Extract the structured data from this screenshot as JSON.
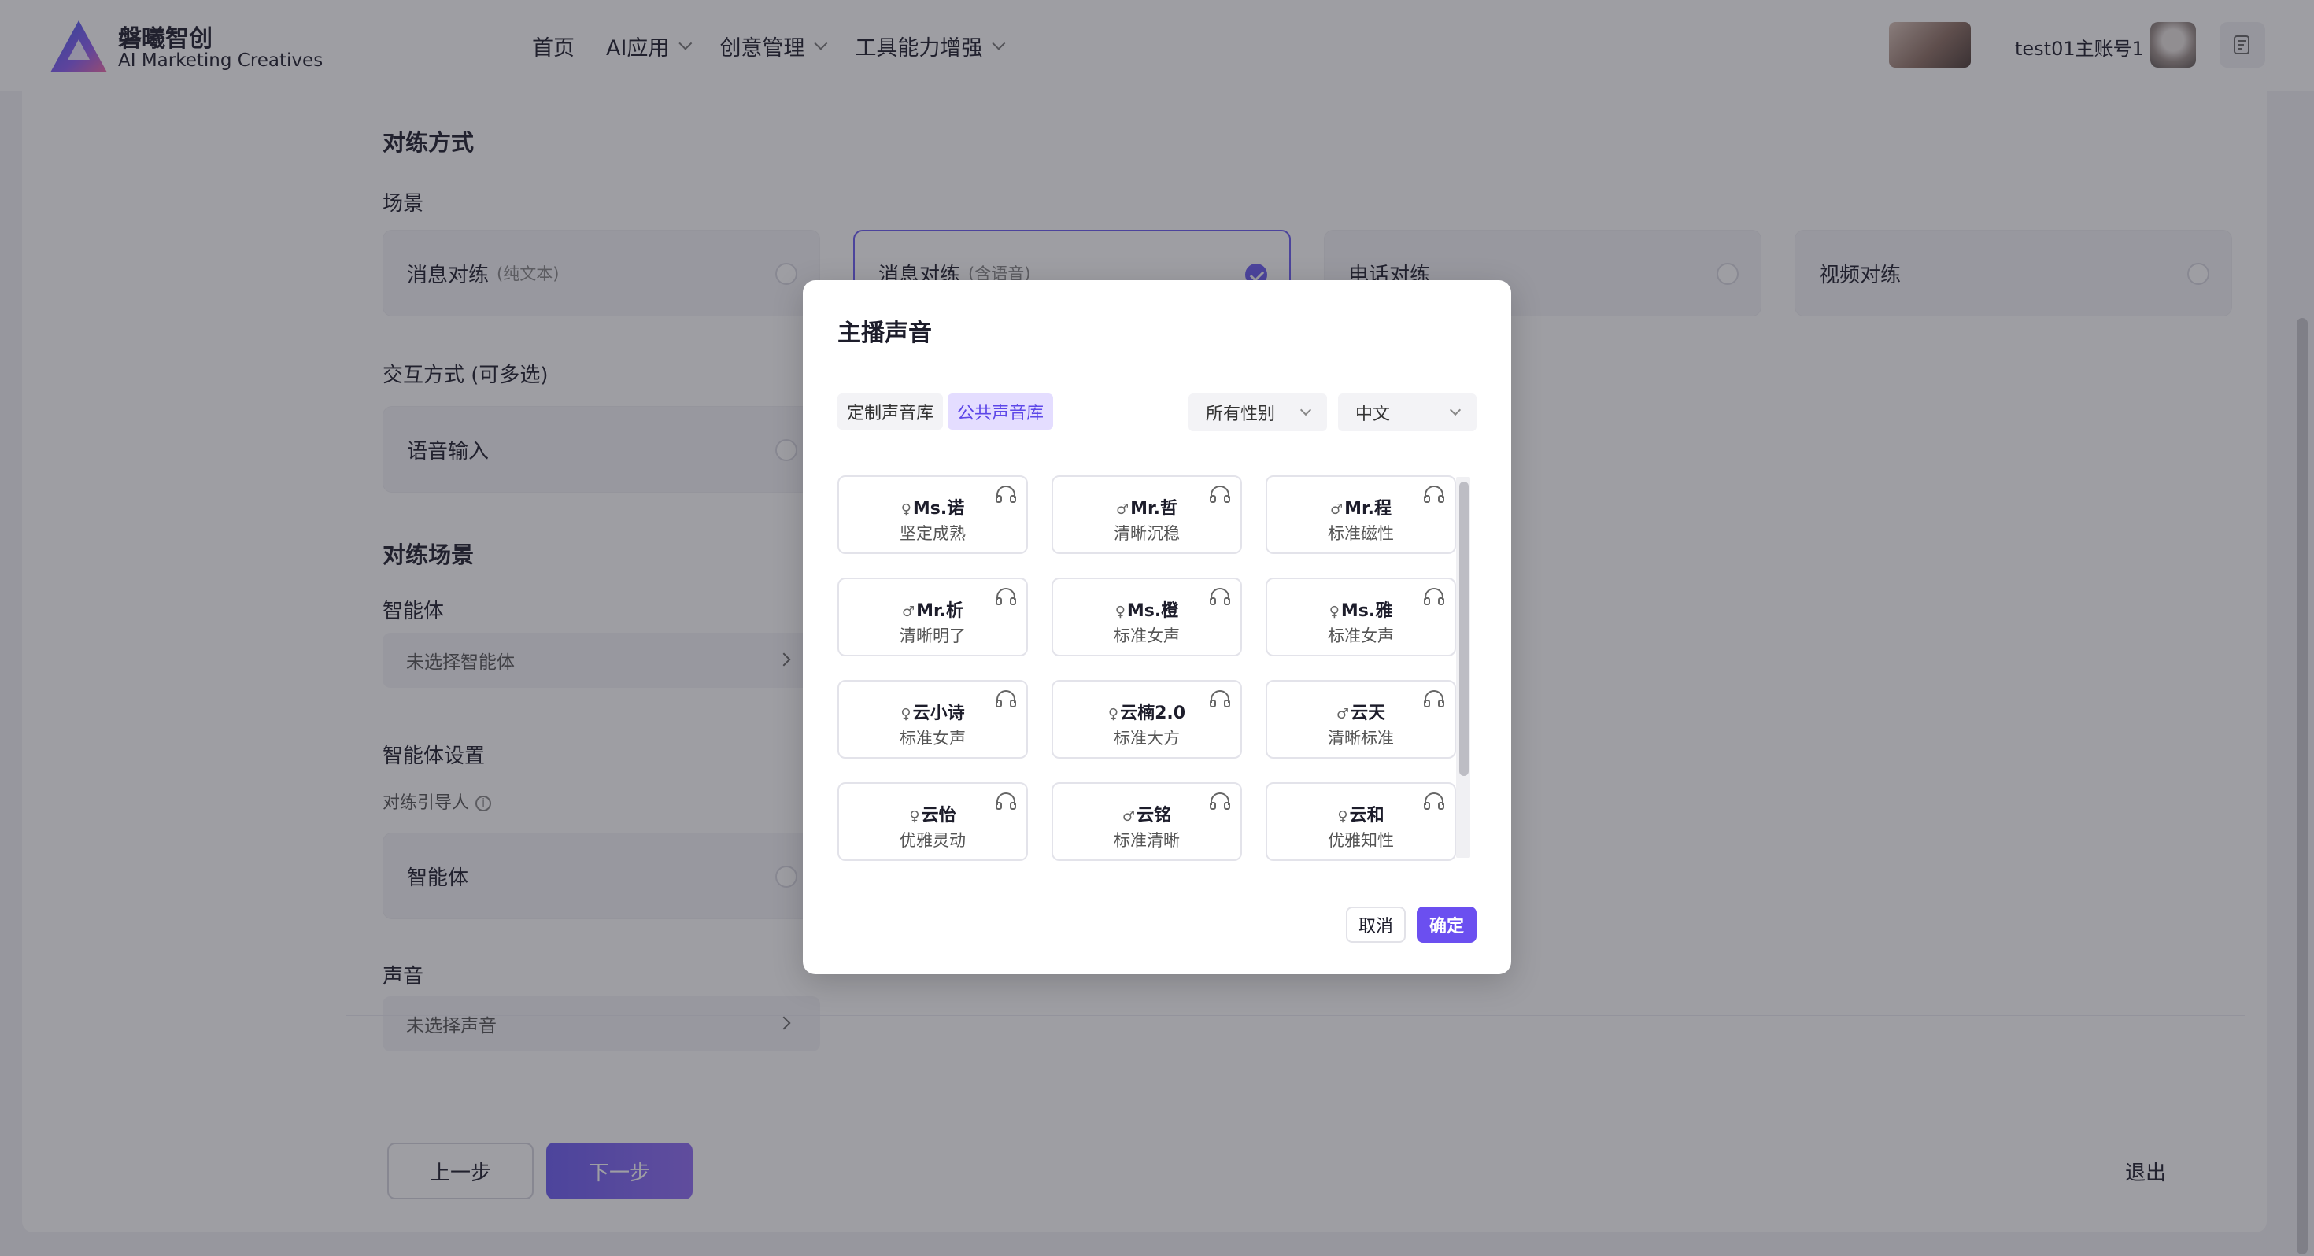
{
  "header": {
    "brand_name": "磐曦智创",
    "brand_sub": "AI Marketing Creatives",
    "nav": [
      {
        "label": "首页",
        "dropdown": false
      },
      {
        "label": "AI应用",
        "dropdown": true
      },
      {
        "label": "创意管理",
        "dropdown": true
      },
      {
        "label": "工具能力增强",
        "dropdown": true
      }
    ],
    "account_name": "test01主账号1"
  },
  "form": {
    "mode_title": "对练方式",
    "scene_label": "场景",
    "scene_options": [
      {
        "label": "消息对练",
        "hint": "(纯文本)",
        "selected": false
      },
      {
        "label": "消息对练",
        "hint": "(含语音)",
        "selected": true
      },
      {
        "label": "电话对练",
        "hint": "",
        "selected": false
      },
      {
        "label": "视频对练",
        "hint": "",
        "selected": false
      }
    ],
    "interaction_label": "交互方式 (可多选)",
    "interaction_option": "语音输入",
    "practice_scene_title": "对练场景",
    "agent_label": "智能体",
    "agent_placeholder": "未选择智能体",
    "agent_settings_title": "智能体设置",
    "guide_label": "对练引导人",
    "guide_info": "i",
    "guide_option": "智能体",
    "voice_label": "声音",
    "voice_placeholder": "未选择声音"
  },
  "footer": {
    "prev": "上一步",
    "next": "下一步",
    "exit": "退出"
  },
  "modal": {
    "title": "主播声音",
    "tabs": [
      {
        "label": "定制声音库",
        "active": false
      },
      {
        "label": "公共声音库",
        "active": true
      }
    ],
    "gender_filter": "所有性别",
    "language_filter": "中文",
    "voices": [
      {
        "gender": "♀",
        "name": "Ms.诺",
        "desc": "坚定成熟"
      },
      {
        "gender": "♂",
        "name": "Mr.哲",
        "desc": "清晰沉稳"
      },
      {
        "gender": "♂",
        "name": "Mr.程",
        "desc": "标准磁性"
      },
      {
        "gender": "♂",
        "name": "Mr.析",
        "desc": "清晰明了"
      },
      {
        "gender": "♀",
        "name": "Ms.橙",
        "desc": "标准女声"
      },
      {
        "gender": "♀",
        "name": "Ms.雅",
        "desc": "标准女声"
      },
      {
        "gender": "♀",
        "name": "云小诗",
        "desc": "标准女声"
      },
      {
        "gender": "♀",
        "name": "云楠2.0",
        "desc": "标准大方"
      },
      {
        "gender": "♂",
        "name": "云天",
        "desc": "清晰标准"
      },
      {
        "gender": "♀",
        "name": "云怡",
        "desc": "优雅灵动"
      },
      {
        "gender": "♂",
        "name": "云铭",
        "desc": "标准清晰"
      },
      {
        "gender": "♀",
        "name": "云和",
        "desc": "优雅知性"
      }
    ],
    "cancel": "取消",
    "confirm": "确定"
  },
  "colors": {
    "accent": "#6b5cf2",
    "overlay": "rgba(40,40,50,0.45)"
  }
}
